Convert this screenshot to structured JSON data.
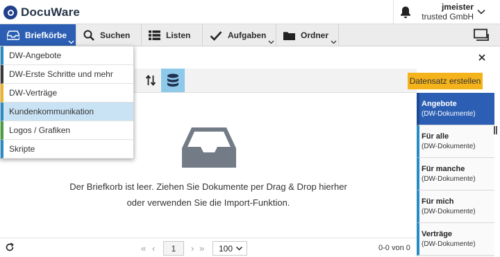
{
  "header": {
    "brand": "DocuWare",
    "user_name": "jmeister",
    "user_org": "trusted GmbH"
  },
  "nav": {
    "items": [
      {
        "label": "Briefkörbe",
        "icon": "inbox-icon",
        "active": true
      },
      {
        "label": "Suchen",
        "icon": "search-icon"
      },
      {
        "label": "Listen",
        "icon": "list-icon"
      },
      {
        "label": "Aufgaben",
        "icon": "checkmark-icon"
      },
      {
        "label": "Ordner",
        "icon": "folder-icon"
      }
    ]
  },
  "dropdown": {
    "items": [
      {
        "label": "DW-Angebote",
        "color": "#2a8bc4"
      },
      {
        "label": "DW-Erste Schritte und mehr",
        "color": "#3a3a3a"
      },
      {
        "label": "DW-Verträge",
        "color": "#f0b429"
      },
      {
        "label": "Kundenkommunikation",
        "color": "#2a8bc4",
        "hover": true
      },
      {
        "label": "Logos / Grafiken",
        "color": "#4a9e3f"
      },
      {
        "label": "Skripte",
        "color": "#2a8bc4"
      }
    ]
  },
  "toolbar": {
    "create_label": "Datensatz erstellen"
  },
  "empty": {
    "line1": "Der Briefkorb ist leer. Ziehen Sie Dokumente per Drag & Drop hierher",
    "line2": "oder verwenden Sie die Import-Funktion."
  },
  "footer": {
    "page": "1",
    "per_page": "100",
    "count": "0-0 von 0"
  },
  "right_panel": {
    "items": [
      {
        "title": "Angebote",
        "subtitle": "(DW-Dokumente)",
        "active": true
      },
      {
        "title": "Für alle",
        "subtitle": "(DW-Dokumente)"
      },
      {
        "title": "Für manche",
        "subtitle": "(DW-Dokumente)"
      },
      {
        "title": "Für mich",
        "subtitle": "(DW-Dokumente)"
      },
      {
        "title": "Verträge",
        "subtitle": "(DW-Dokumente)"
      }
    ]
  },
  "colors": {
    "accent": "#2c5fb3",
    "create_button": "#f5b31b",
    "db_button": "#8ec9ea"
  }
}
